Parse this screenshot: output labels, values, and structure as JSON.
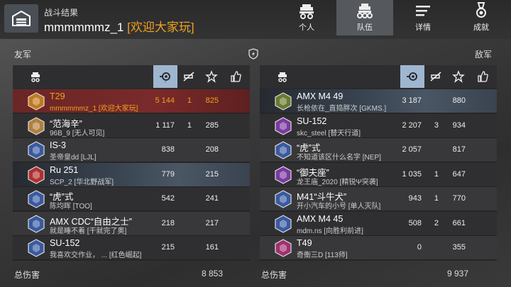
{
  "header": {
    "subtitle": "战斗结果",
    "player": "mmmmmmz_1",
    "clan": "[欢迎大家玩]",
    "tabs": [
      {
        "label": "个人",
        "icon": "tank-icon"
      },
      {
        "label": "队伍",
        "icon": "team-icon"
      },
      {
        "label": "详情",
        "icon": "list-icon"
      },
      {
        "label": "成就",
        "icon": "medal-icon"
      }
    ],
    "active_tab": "队伍"
  },
  "allies": {
    "label": "友军",
    "total_label": "总伤害",
    "total": "8 853",
    "rows": [
      {
        "tank": "T29",
        "player": "mmmmmmz_1 [欢迎大家玩]",
        "damage": "5 144",
        "kills": "1",
        "exp": "825",
        "style": "hl",
        "color": "#f0a020"
      },
      {
        "tank": "“范海辛”",
        "player": "96B_9 [无人可见]",
        "damage": "1 117",
        "kills": "1",
        "exp": "285",
        "style": "plain"
      },
      {
        "tank": "IS-3",
        "player": "圣帝皇dd [LJL]",
        "damage": "838",
        "kills": "",
        "exp": "208",
        "style": "alt"
      },
      {
        "tank": "Ru 251",
        "player": "SCP_2 [华北野战军]",
        "damage": "779",
        "kills": "",
        "exp": "215",
        "style": "hl-photo"
      },
      {
        "tank": "“虎”式",
        "player": "陈均晖 [TOO]",
        "damage": "542",
        "kills": "",
        "exp": "241",
        "style": "plain"
      },
      {
        "tank": "AMX CDC“自由之士”",
        "player": "就是睡不着 [干就完了奥]",
        "damage": "218",
        "kills": "",
        "exp": "217",
        "style": "alt"
      },
      {
        "tank": "SU-152",
        "player": "我喜欢交作业， ...    [红色崛起]",
        "damage": "215",
        "kills": "",
        "exp": "161",
        "style": "plain"
      }
    ]
  },
  "enemies": {
    "label": "敌军",
    "total_label": "总伤害",
    "total": "9 937",
    "rows": [
      {
        "tank": "AMX M4 49",
        "player": "长枪依在_直捣胖次 [GKMS.]",
        "damage": "3 187",
        "kills": "",
        "exp": "880",
        "style": "hl-photo"
      },
      {
        "tank": "SU-152",
        "player": "skc_steel [替天行道]",
        "damage": "2 207",
        "kills": "3",
        "exp": "934",
        "style": "plain"
      },
      {
        "tank": "“虎”式",
        "player": "不知道该区什么名字 [NEP]",
        "damage": "2 057",
        "kills": "",
        "exp": "817",
        "style": "alt"
      },
      {
        "tank": "“御夫座”",
        "player": "龙王庙_2020 [精锐Ψ突袭]",
        "damage": "1 035",
        "kills": "1",
        "exp": "647",
        "style": "plain"
      },
      {
        "tank": "M41“斗牛犬”",
        "player": "开小汽车的小号 [单人灭队]",
        "damage": "943",
        "kills": "1",
        "exp": "770",
        "style": "alt"
      },
      {
        "tank": "AMX M4 45",
        "player": "mdm.ns [向胜利前进]",
        "damage": "508",
        "kills": "2",
        "exp": "661",
        "style": "plain"
      },
      {
        "tank": "T49",
        "player": "奇衡三D [113师]",
        "damage": "0",
        "kills": "",
        "exp": "355",
        "style": "alt"
      }
    ]
  }
}
